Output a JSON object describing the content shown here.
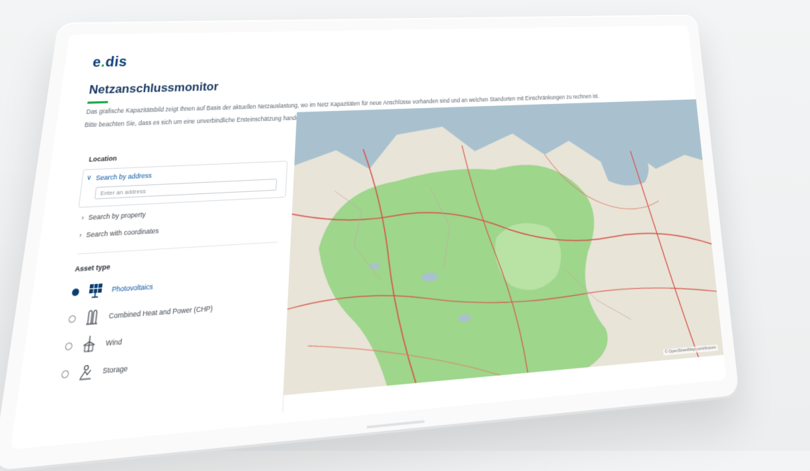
{
  "header": {
    "logo_prefix": "e",
    "logo_dot": ".",
    "logo_suffix": "dis",
    "title": "Netzanschlussmonitor"
  },
  "intro": {
    "paragraph1": "Das grafische Kapazitätsbild zeigt Ihnen auf Basis der aktuellen Netzauslastung, wo im Netz Kapazitäten für neue Anschlüsse vorhanden sind und an welchen Standorten mit Einschränkungen zu rechnen ist.",
    "paragraph2": "Bitte beachten Sie, dass es sich um eine unverbindliche Ersteinschätzung handelt und die tatsächliche Anschlussmöglichkeit im Rahmen einer Netzverträglichkeitsprüfung ermittelt wird."
  },
  "panel": {
    "location_title": "Location",
    "search_by_address": "Search by address",
    "address_placeholder": "Enter an address",
    "search_by_property": "Search by property",
    "search_with_coordinates": "Search with coordinates",
    "asset_type_title": "Asset type",
    "assets": [
      {
        "label": "Photovoltaics",
        "icon": "solar-panel-icon",
        "selected": true
      },
      {
        "label": "Combined Heat and Power (CHP)",
        "icon": "chp-icon",
        "selected": false
      },
      {
        "label": "Wind",
        "icon": "wind-turbine-icon",
        "selected": false
      },
      {
        "label": "Storage",
        "icon": "storage-icon",
        "selected": false
      }
    ]
  },
  "map": {
    "attribution": "© OpenStreetMap contributors",
    "colors": {
      "water": "#a9c1cf",
      "land": "#e8e4d8",
      "green_area": "#9ed68c",
      "roads": "#d7534a"
    }
  }
}
